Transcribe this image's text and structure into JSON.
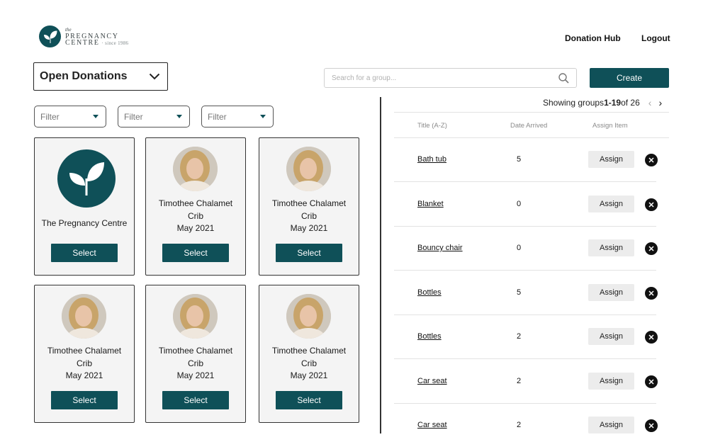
{
  "brand": {
    "the": "the",
    "name": "PREGNANCY",
    "name2": "CENTRE",
    "since": "· since 1986",
    "color": "#0f5058"
  },
  "nav": {
    "hub": "Donation Hub",
    "logout": "Logout"
  },
  "status_select": {
    "value": "Open Donations"
  },
  "search": {
    "placeholder": "Search for a group..."
  },
  "create_label": "Create",
  "filters": [
    "Filter",
    "Filter",
    "Filter"
  ],
  "cards": [
    {
      "type": "organisation",
      "name": "The Pregnancy Centre",
      "button": "Select"
    },
    {
      "type": "person",
      "name": "Timothee Chalamet",
      "item": "Crib",
      "date": "May 2021",
      "button": "Select"
    },
    {
      "type": "person",
      "name": "Timothee Chalamet",
      "item": "Crib",
      "date": "May 2021",
      "button": "Select"
    },
    {
      "type": "person",
      "name": "Timothee Chalamet",
      "item": "Crib",
      "date": "May 2021",
      "button": "Select"
    },
    {
      "type": "person",
      "name": "Timothee Chalamet",
      "item": "Crib",
      "date": "May 2021",
      "button": "Select"
    },
    {
      "type": "person",
      "name": "Timothee Chalamet",
      "item": "Crib",
      "date": "May 2021",
      "button": "Select"
    }
  ],
  "pager": {
    "prefix": "Showing groups ",
    "range": "1-19",
    "suffix": " of 26",
    "prev": "‹",
    "next": "›"
  },
  "table": {
    "headers": {
      "title": "Title (A-Z)",
      "date": "Date Arrived",
      "assign": "Assign Item"
    },
    "rows": [
      {
        "title": "Bath tub",
        "count": "5",
        "action": "Assign"
      },
      {
        "title": "Blanket",
        "count": "0",
        "action": "Assign"
      },
      {
        "title": "Bouncy chair",
        "count": "0",
        "action": "Assign"
      },
      {
        "title": "Bottles",
        "count": "5",
        "action": "Assign"
      },
      {
        "title": "Bottles",
        "count": "2",
        "action": "Assign"
      },
      {
        "title": "Car seat",
        "count": "2",
        "action": "Assign"
      },
      {
        "title": "Car seat",
        "count": "2",
        "action": "Assign"
      }
    ]
  }
}
